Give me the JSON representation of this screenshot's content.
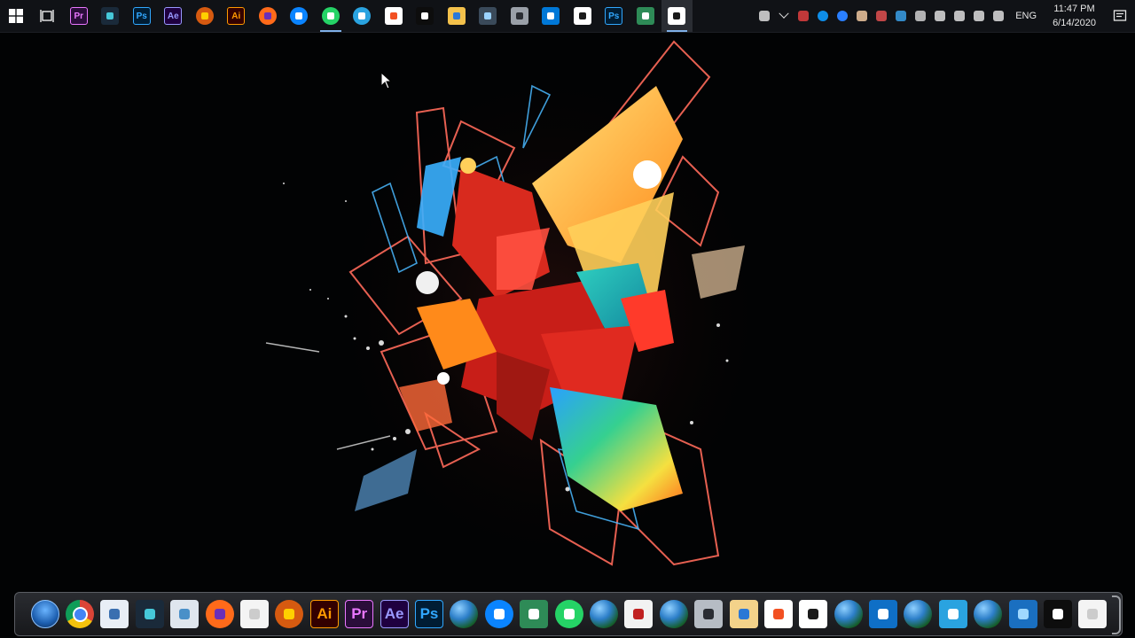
{
  "taskbar": {
    "items": [
      {
        "name": "start",
        "icon": "windows-logo-icon",
        "text": ""
      },
      {
        "name": "task-view",
        "icon": "task-view-icon",
        "text": ""
      },
      {
        "name": "premiere",
        "icon": "premiere-icon",
        "text": "Pr",
        "bg": "#2a0d3a",
        "fg": "#ea77ff",
        "border": "#ea77ff"
      },
      {
        "name": "filmora",
        "icon": "filmora-icon",
        "text": "",
        "bg": "#1a2a3a",
        "fg": "#46c8d9"
      },
      {
        "name": "photoshop",
        "icon": "photoshop-icon",
        "text": "Ps",
        "bg": "#001d34",
        "fg": "#31a8ff",
        "border": "#31a8ff"
      },
      {
        "name": "after-effects",
        "icon": "after-effects-icon",
        "text": "Ae",
        "bg": "#1f0040",
        "fg": "#9999ff",
        "border": "#9999ff"
      },
      {
        "name": "app-orange",
        "icon": "orange-app-icon",
        "text": "",
        "bg": "#d65a10",
        "fg": "#ffd000",
        "round": true
      },
      {
        "name": "illustrator",
        "icon": "illustrator-icon",
        "text": "Ai",
        "bg": "#330000",
        "fg": "#ff9a00",
        "border": "#ff9a00"
      },
      {
        "name": "firefox",
        "icon": "firefox-icon",
        "text": "",
        "bg": "#ff6a1a",
        "fg": "#6a2fb8",
        "round": true
      },
      {
        "name": "messenger",
        "icon": "messenger-icon",
        "text": "",
        "bg": "#0a84ff",
        "fg": "#ffffff",
        "round": true
      },
      {
        "name": "whatsapp",
        "icon": "whatsapp-icon",
        "text": "",
        "bg": "#25d366",
        "fg": "#ffffff",
        "round": true,
        "running": true
      },
      {
        "name": "telegram",
        "icon": "telegram-icon",
        "text": "",
        "bg": "#2aa3e0",
        "fg": "#ffffff",
        "round": true
      },
      {
        "name": "store",
        "icon": "store-bag-icon",
        "text": "",
        "bg": "#ffffff",
        "fg": "#f25022"
      },
      {
        "name": "dolby",
        "icon": "dolby-icon",
        "text": "",
        "bg": "#0d0d0d",
        "fg": "#ffffff"
      },
      {
        "name": "file-explorer",
        "icon": "folder-icon",
        "text": "",
        "bg": "#f3c14b",
        "fg": "#2b78d6"
      },
      {
        "name": "app-device",
        "icon": "device-icon",
        "text": "",
        "bg": "#3a4a5a",
        "fg": "#9bd3ff"
      },
      {
        "name": "camera",
        "icon": "camera-icon",
        "text": "",
        "bg": "#9aa0a8",
        "fg": "#2a2d33"
      },
      {
        "name": "feedback",
        "icon": "speech-bubble-icon",
        "text": "",
        "bg": "#0078d7",
        "fg": "#ffffff"
      },
      {
        "name": "photos",
        "icon": "photos-icon",
        "text": "",
        "bg": "#ffffff",
        "fg": "#1a1a1a"
      },
      {
        "name": "photoshop-2",
        "icon": "photoshop-icon",
        "text": "Ps",
        "bg": "#001d34",
        "fg": "#31a8ff",
        "border": "#31a8ff"
      },
      {
        "name": "camtasia-green",
        "icon": "camtasia-icon",
        "text": "",
        "bg": "#2e8b57",
        "fg": "#ffffff"
      },
      {
        "name": "camtasia",
        "icon": "camtasia-icon",
        "text": "",
        "bg": "#ffffff",
        "fg": "#1a1a1a",
        "active": true,
        "running": true
      }
    ],
    "tray": {
      "icons": [
        {
          "name": "people",
          "icon": "people-icon",
          "color": "#dddddd"
        },
        {
          "name": "chevron",
          "icon": "chevron-up-icon",
          "color": "#dddddd"
        },
        {
          "name": "antivirus",
          "icon": "shield-icon",
          "color": "#e04040"
        },
        {
          "name": "teamviewer",
          "icon": "teamviewer-icon",
          "color": "#0e8ee9"
        },
        {
          "name": "bluetooth",
          "icon": "bluetooth-icon",
          "color": "#2a7fff"
        },
        {
          "name": "tray-app",
          "icon": "hand-icon",
          "color": "#f0c8a0"
        },
        {
          "name": "tray-app-2",
          "icon": "tools-icon",
          "color": "#e05050"
        },
        {
          "name": "display",
          "icon": "display-icon",
          "color": "#3aa0e8"
        },
        {
          "name": "onedrive",
          "icon": "cloud-icon",
          "color": "#cfcfcf"
        },
        {
          "name": "battery",
          "icon": "battery-icon",
          "color": "#dddddd"
        },
        {
          "name": "wifi",
          "icon": "wifi-icon",
          "color": "#dddddd"
        },
        {
          "name": "volume",
          "icon": "speaker-icon",
          "color": "#dddddd"
        },
        {
          "name": "keyboard",
          "icon": "keyboard-icon",
          "color": "#dddddd"
        }
      ],
      "language": "ENG",
      "time": "11:47 PM",
      "date": "6/14/2020"
    }
  },
  "dock": {
    "items": [
      {
        "name": "windows-orb",
        "icon": "windows-orb-icon",
        "text": "",
        "kind": "orb"
      },
      {
        "name": "chrome",
        "icon": "chrome-icon",
        "text": "",
        "kind": "chrome"
      },
      {
        "name": "documents",
        "icon": "documents-icon",
        "text": "",
        "bg": "#e8eef6",
        "fg": "#3a6fb0"
      },
      {
        "name": "filmora",
        "icon": "filmora-icon",
        "text": "",
        "bg": "#1a2a3a",
        "fg": "#46c8d9"
      },
      {
        "name": "recycle-bin",
        "icon": "recycle-bin-icon",
        "text": "",
        "bg": "#dfe6ee",
        "fg": "#4a90c8"
      },
      {
        "name": "firefox",
        "icon": "firefox-icon",
        "text": "",
        "bg": "#ff6a1a",
        "fg": "#6a2fb8",
        "round": true
      },
      {
        "name": "blank-file",
        "icon": "blank-file-icon",
        "text": "",
        "bg": "#f4f4f4",
        "fg": "#cccccc"
      },
      {
        "name": "orange-app",
        "icon": "orange-app-icon",
        "text": "",
        "bg": "#d65a10",
        "fg": "#ffd000",
        "round": true
      },
      {
        "name": "illustrator",
        "icon": "illustrator-icon",
        "text": "Ai",
        "bg": "#330000",
        "fg": "#ff9a00",
        "border": "#ff9a00"
      },
      {
        "name": "premiere",
        "icon": "premiere-icon",
        "text": "Pr",
        "bg": "#2a0d3a",
        "fg": "#ea77ff",
        "border": "#ea77ff"
      },
      {
        "name": "after-effects",
        "icon": "after-effects-icon",
        "text": "Ae",
        "bg": "#1f0040",
        "fg": "#9999ff",
        "border": "#9999ff"
      },
      {
        "name": "photoshop",
        "icon": "photoshop-icon",
        "text": "Ps",
        "bg": "#001d34",
        "fg": "#31a8ff",
        "border": "#31a8ff"
      },
      {
        "name": "globe-1",
        "icon": "globe-icon",
        "text": "",
        "kind": "globe"
      },
      {
        "name": "messenger",
        "icon": "messenger-icon",
        "text": "",
        "bg": "#0a84ff",
        "fg": "#ffffff",
        "round": true
      },
      {
        "name": "camtasia-green",
        "icon": "camtasia-icon",
        "text": "",
        "bg": "#2e8b57",
        "fg": "#ffffff"
      },
      {
        "name": "whatsapp",
        "icon": "whatsapp-icon",
        "text": "",
        "bg": "#25d366",
        "fg": "#ffffff",
        "round": true
      },
      {
        "name": "globe-2",
        "icon": "globe-icon",
        "text": "",
        "kind": "globe"
      },
      {
        "name": "video-editor",
        "icon": "video-editor-icon",
        "text": "",
        "bg": "#f2f2f2",
        "fg": "#c02020"
      },
      {
        "name": "globe-3",
        "icon": "globe-icon",
        "text": "",
        "kind": "globe"
      },
      {
        "name": "camera",
        "icon": "camera-icon",
        "text": "",
        "bg": "#b6bcc4",
        "fg": "#2a2d33"
      },
      {
        "name": "file-app",
        "icon": "file-icon",
        "text": "",
        "bg": "#f3d28a",
        "fg": "#2b78d6"
      },
      {
        "name": "store",
        "icon": "store-bag-icon",
        "text": "",
        "bg": "#ffffff",
        "fg": "#f25022"
      },
      {
        "name": "photos",
        "icon": "photos-icon",
        "text": "",
        "bg": "#ffffff",
        "fg": "#1a1a1a"
      },
      {
        "name": "globe-4",
        "icon": "globe-icon",
        "text": "",
        "kind": "globe"
      },
      {
        "name": "blue-app",
        "icon": "blue-square-icon",
        "text": "",
        "bg": "#0f6fc6",
        "fg": "#ffffff"
      },
      {
        "name": "globe-5",
        "icon": "globe-icon",
        "text": "",
        "kind": "globe"
      },
      {
        "name": "telegram",
        "icon": "telegram-icon",
        "text": "",
        "bg": "#2aa3e0",
        "fg": "#ffffff"
      },
      {
        "name": "globe-6",
        "icon": "globe-icon",
        "text": "",
        "kind": "globe"
      },
      {
        "name": "cube-app",
        "icon": "cube-icon",
        "text": "",
        "bg": "#1a6fc0",
        "fg": "#9fd8ff"
      },
      {
        "name": "dolby",
        "icon": "dolby-icon",
        "text": "",
        "bg": "#0d0d0d",
        "fg": "#ffffff"
      },
      {
        "name": "blank-file-2",
        "icon": "blank-file-icon",
        "text": "",
        "bg": "#f4f4f4",
        "fg": "#cccccc"
      }
    ]
  },
  "colors": {
    "taskbar_bg": "#101216",
    "desktop_bg": "#020304",
    "accent": "#7fb0e8"
  }
}
